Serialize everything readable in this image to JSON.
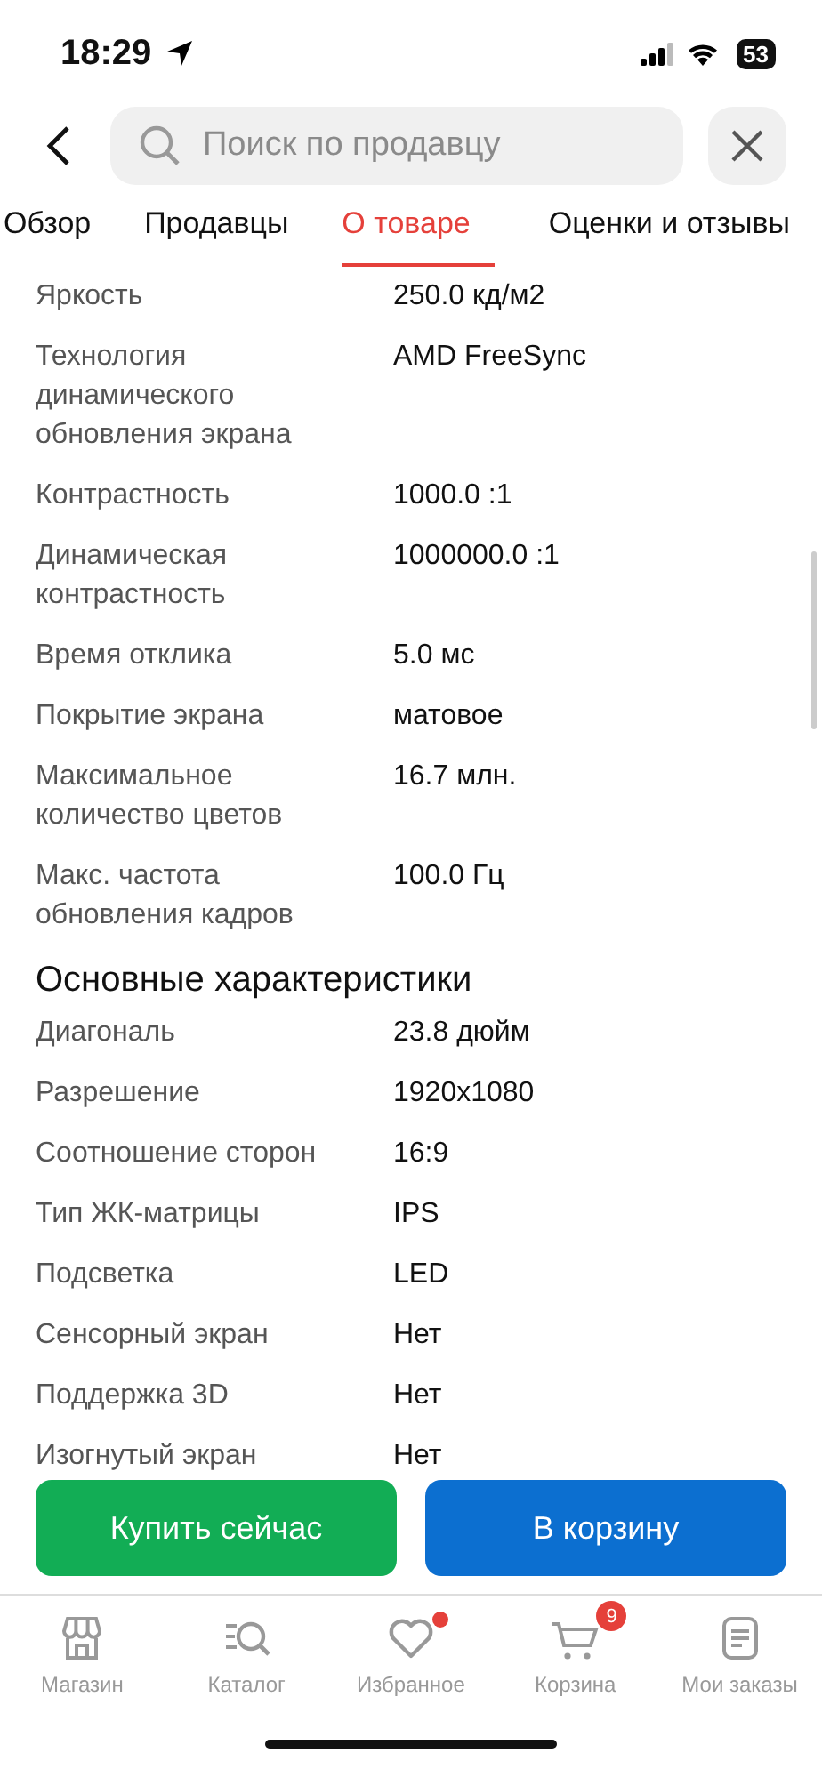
{
  "status_bar": {
    "time": "18:29",
    "battery": "53"
  },
  "search": {
    "placeholder": "Поиск по продавцу"
  },
  "tabs": [
    {
      "label": "Обзор",
      "selected": false
    },
    {
      "label": "Продавцы",
      "selected": false
    },
    {
      "label": "О товаре",
      "selected": true
    },
    {
      "label": "Оценки и отзывы",
      "selected": false
    }
  ],
  "sections": [
    {
      "rows": [
        {
          "label": "Яркость",
          "value": "250.0 кд/м2"
        },
        {
          "label": "Технология динамического обновления экрана",
          "value": "AMD FreeSync"
        },
        {
          "label": "Контрастность",
          "value": "1000.0 :1"
        },
        {
          "label": "Динамическая контрастность",
          "value": "1000000.0 :1"
        },
        {
          "label": "Время отклика",
          "value": "5.0 мс"
        },
        {
          "label": "Покрытие экрана",
          "value": "матовое"
        },
        {
          "label": "Максимальное количество цветов",
          "value": "16.7 млн."
        },
        {
          "label": "Макс. частота обновления кадров",
          "value": "100.0 Гц"
        }
      ]
    },
    {
      "title": "Основные характеристики",
      "rows": [
        {
          "label": "Диагональ",
          "value": "23.8 дюйм"
        },
        {
          "label": "Разрешение",
          "value": "1920x1080"
        },
        {
          "label": "Соотношение сторон",
          "value": "16:9"
        },
        {
          "label": "Тип ЖК-матрицы",
          "value": "IPS"
        },
        {
          "label": "Подсветка",
          "value": "LED"
        },
        {
          "label": "Сенсорный экран",
          "value": "Нет"
        },
        {
          "label": "Поддержка 3D",
          "value": "Нет"
        },
        {
          "label": "Изогнутый экран",
          "value": "Нет"
        }
      ]
    }
  ],
  "buttons": [
    {
      "kind": "buy",
      "label": "Купить сейчас"
    },
    {
      "kind": "cart",
      "label": "В корзину"
    }
  ],
  "bottom_nav": [
    {
      "kind": "store",
      "label": "Магазин",
      "dot": false
    },
    {
      "kind": "catalog",
      "label": "Каталог",
      "dot": false
    },
    {
      "kind": "favorites",
      "label": "Избранное",
      "dot": true
    },
    {
      "kind": "cart",
      "label": "Корзина",
      "dot": false,
      "badge": "9"
    },
    {
      "kind": "orders",
      "label": "Мои заказы",
      "dot": false
    }
  ]
}
